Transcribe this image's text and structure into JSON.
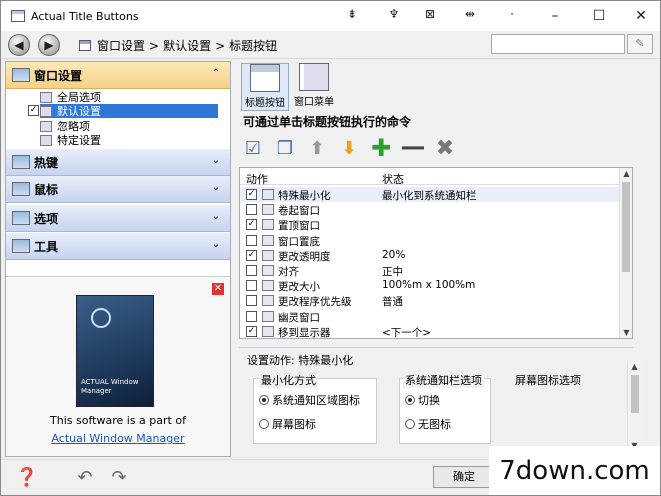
{
  "window": {
    "title": "Actual Title Buttons"
  },
  "title_buttons": [
    "pin-icon",
    "rollup-icon",
    "minimize-to-tray-icon",
    "move-to-monitor-icon"
  ],
  "caption": {
    "minimize": "–",
    "maximize": "☐",
    "close": "✕"
  },
  "nav": {
    "back": "◀",
    "forward": "▶",
    "crumbs": [
      "窗口设置",
      ">",
      "默认设置",
      ">",
      "标题按钮"
    ],
    "search_placeholder": "",
    "search_button": "✎"
  },
  "left": {
    "groups": [
      {
        "label": "窗口设置",
        "chevron": "⌃",
        "active": true
      },
      {
        "label": "热键",
        "chevron": "⌄"
      },
      {
        "label": "鼠标",
        "chevron": "⌄"
      },
      {
        "label": "选项",
        "chevron": "⌄"
      },
      {
        "label": "工具",
        "chevron": "⌄"
      }
    ],
    "sub_items": [
      {
        "label": "全局选项"
      },
      {
        "label": "默认设置",
        "selected": true
      },
      {
        "label": "忽略项"
      },
      {
        "label": "特定设置"
      }
    ],
    "checkmark": "✓",
    "ad": {
      "close": "✕",
      "box_text": "ACTUAL Window Manager",
      "text": "This software is a part of",
      "link": "Actual Window Manager"
    }
  },
  "right": {
    "tabs": [
      {
        "label": "标题按钮",
        "active": true
      },
      {
        "label": "窗口菜单"
      }
    ],
    "heading": "可通过单击标题按钮执行的命令",
    "toolbar_icons": [
      "add-check-icon",
      "copy-icon",
      "up-arrow-icon",
      "down-arrow-icon",
      "plus-icon",
      "separator-icon",
      "delete-icon"
    ],
    "table": {
      "headers": [
        "动作",
        "状态"
      ],
      "rows": [
        {
          "action": "特殊最小化",
          "status": "最小化到系统通知栏",
          "checked": true,
          "highlight": true
        },
        {
          "action": "卷起窗口",
          "status": "",
          "checked": false
        },
        {
          "action": "置顶窗口",
          "status": "",
          "checked": true
        },
        {
          "action": "窗口置底",
          "status": "",
          "checked": false
        },
        {
          "action": "更改透明度",
          "status": "20%",
          "checked": true
        },
        {
          "action": "对齐",
          "status": "正中",
          "checked": false
        },
        {
          "action": "更改大小",
          "status": "100%m x 100%m",
          "checked": false
        },
        {
          "action": "更改程序优先级",
          "status": "普通",
          "checked": false
        },
        {
          "action": "幽灵窗口",
          "status": "",
          "checked": false
        },
        {
          "action": "移到显示器",
          "status": "<下一个>",
          "checked": true
        }
      ]
    },
    "settings": {
      "title": "设置动作: 特殊最小化",
      "col1": {
        "title": "最小化方式",
        "opt1": "系统通知区域图标",
        "opt2": "屏幕图标"
      },
      "col2": {
        "title": "系统通知栏选项",
        "opt1": "切换",
        "opt2": "无图标"
      },
      "col3": {
        "title": "屏幕图标选项"
      }
    }
  },
  "bottom": {
    "ok": "确定"
  },
  "watermark": "7down.com"
}
